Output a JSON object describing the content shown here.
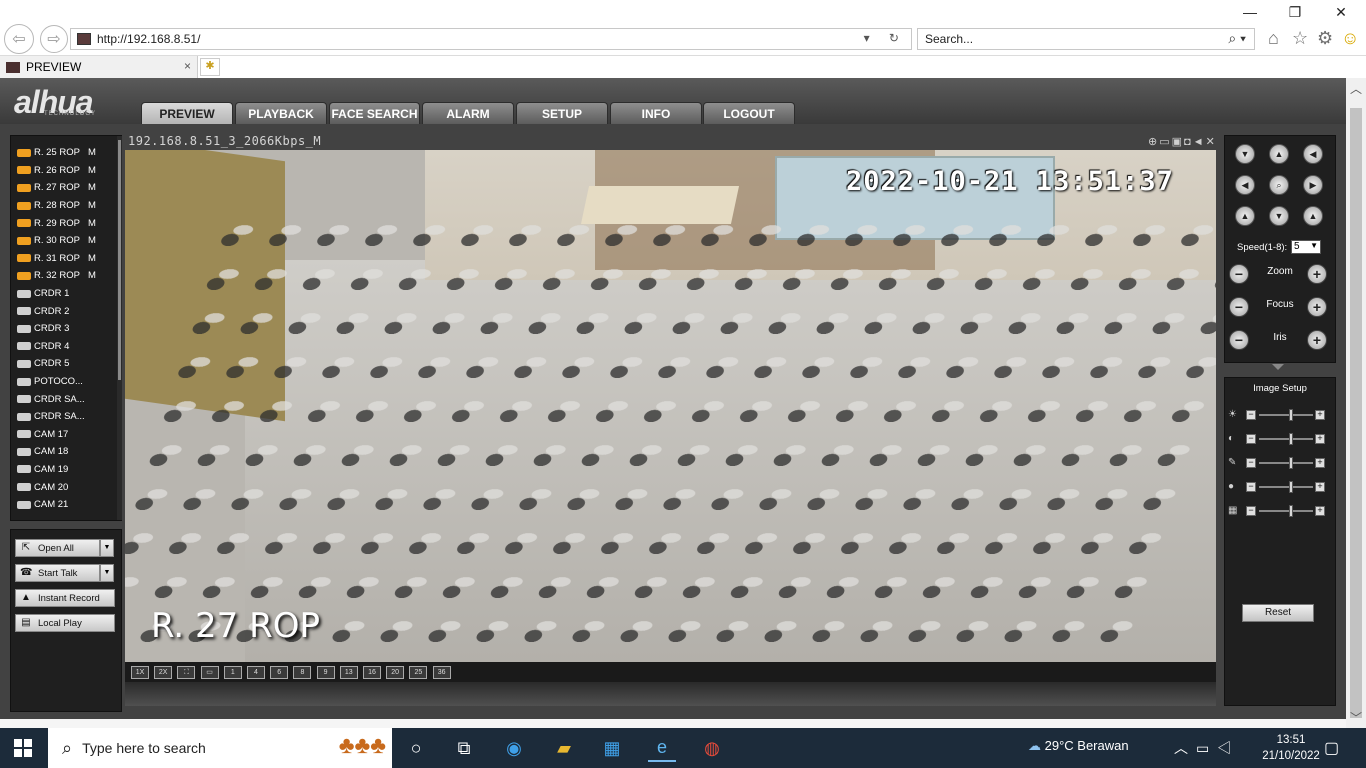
{
  "browser": {
    "url": "http://192.168.8.51/",
    "search_placeholder": "Search...",
    "tab_title": "PREVIEW",
    "tab_close": "×"
  },
  "app": {
    "logo": "alhua",
    "logo_sub": "TECHNOLOGY",
    "tabs": [
      "PREVIEW",
      "PLAYBACK",
      "FACE SEARCH",
      "ALARM",
      "SETUP",
      "INFO",
      "LOGOUT"
    ],
    "active_tab": "PREVIEW"
  },
  "cameras": [
    {
      "name": "R. 25 ROP",
      "tag": "M",
      "status": "active"
    },
    {
      "name": "R. 26 ROP",
      "tag": "M",
      "status": "active"
    },
    {
      "name": "R. 27 ROP",
      "tag": "M",
      "status": "active"
    },
    {
      "name": "R. 28 ROP",
      "tag": "M",
      "status": "active"
    },
    {
      "name": "R. 29 ROP",
      "tag": "M",
      "status": "active"
    },
    {
      "name": "R. 30 ROP",
      "tag": "M",
      "status": "active"
    },
    {
      "name": "R. 31 ROP",
      "tag": "M",
      "status": "active"
    },
    {
      "name": "R. 32 ROP",
      "tag": "M",
      "status": "active"
    },
    {
      "name": "CRDR 1",
      "tag": "",
      "status": "idle"
    },
    {
      "name": "CRDR 2",
      "tag": "",
      "status": "idle"
    },
    {
      "name": "CRDR 3",
      "tag": "",
      "status": "idle"
    },
    {
      "name": "CRDR 4",
      "tag": "",
      "status": "idle"
    },
    {
      "name": "CRDR 5",
      "tag": "",
      "status": "idle"
    },
    {
      "name": "POTOCO...",
      "tag": "",
      "status": "idle"
    },
    {
      "name": "CRDR SA...",
      "tag": "",
      "status": "idle"
    },
    {
      "name": "CRDR SA...",
      "tag": "",
      "status": "idle"
    },
    {
      "name": "CAM 17",
      "tag": "",
      "status": "idle"
    },
    {
      "name": "CAM 18",
      "tag": "",
      "status": "idle"
    },
    {
      "name": "CAM 19",
      "tag": "",
      "status": "idle"
    },
    {
      "name": "CAM 20",
      "tag": "",
      "status": "idle"
    },
    {
      "name": "CAM 21",
      "tag": "",
      "status": "idle"
    }
  ],
  "left_buttons": {
    "open_all": "Open All",
    "start_talk": "Start Talk",
    "instant_record": "Instant Record",
    "local_play": "Local Play"
  },
  "video": {
    "stream_title": "192.168.8.51_3_2066Kbps_M",
    "overlay_datetime": "2022-10-21  13:51:37",
    "overlay_name": "R. 27 ROP",
    "layout_options": [
      "1X",
      "2X",
      "⛶",
      "▭",
      "1",
      "4",
      "6",
      "8",
      "9",
      "13",
      "16",
      "20",
      "25",
      "36"
    ]
  },
  "ptz": {
    "speed_label": "Speed(1-8):",
    "speed_value": "5",
    "zoom_label": "Zoom",
    "focus_label": "Focus",
    "iris_label": "Iris"
  },
  "image_setup": {
    "title": "Image Setup",
    "reset_label": "Reset",
    "sliders": [
      {
        "name": "brightness",
        "icon": "sun-icon",
        "level": 0.55
      },
      {
        "name": "contrast",
        "icon": "contrast-icon",
        "level": 0.55
      },
      {
        "name": "saturation",
        "icon": "saturation-icon",
        "level": 0.55
      },
      {
        "name": "hue",
        "icon": "hue-icon",
        "level": 0.55
      },
      {
        "name": "gain",
        "icon": "gain-icon",
        "level": 0.55
      }
    ]
  },
  "taskbar": {
    "search_placeholder": "Type here to search",
    "weather": "29°C  Berawan",
    "time": "13:51",
    "date": "21/10/2022"
  },
  "colors": {
    "active_cam": "#f0a020",
    "idle_cam": "#d0d0d0"
  }
}
